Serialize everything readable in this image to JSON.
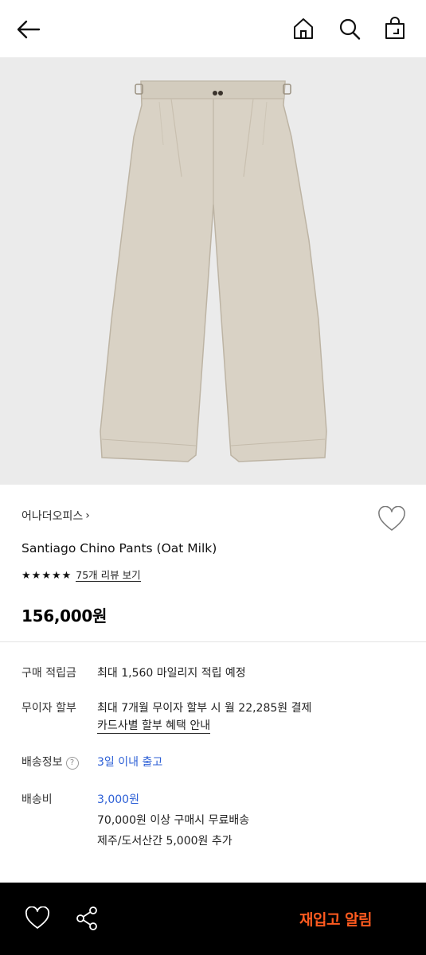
{
  "header": {
    "back_icon": "arrow-left-icon",
    "home_icon": "home-icon",
    "search_icon": "search-icon",
    "bag_icon": "shopping-bag-icon"
  },
  "product": {
    "brand": "어나더오피스",
    "brand_chevron": "›",
    "name": "Santiago Chino Pants (Oat Milk)",
    "rating_stars": 5,
    "review_link": "75개 리뷰 보기",
    "price": "156,000원",
    "image_color": "#d9d2c5"
  },
  "info": {
    "points": {
      "label": "구매 적립금",
      "value": "최대 1,560 마일리지 적립 예정"
    },
    "installment": {
      "label": "무이자 할부",
      "value": "최대 7개월 무이자 할부 시 월 22,285원 결제",
      "link": "카드사별 할부 혜택 안내"
    },
    "shipping_info": {
      "label": "배송정보",
      "help": "?",
      "value": "3일 이내 출고"
    },
    "shipping_fee": {
      "label": "배송비",
      "value": "3,000원",
      "free": "70,000원 이상 구매시 무료배송",
      "extra": "제주/도서산간 5,000원 추가"
    }
  },
  "bottom_bar": {
    "heart_icon": "heart-icon",
    "share_icon": "share-icon",
    "restock_label": "재입고 알림",
    "accent": "#ff5a1f"
  }
}
